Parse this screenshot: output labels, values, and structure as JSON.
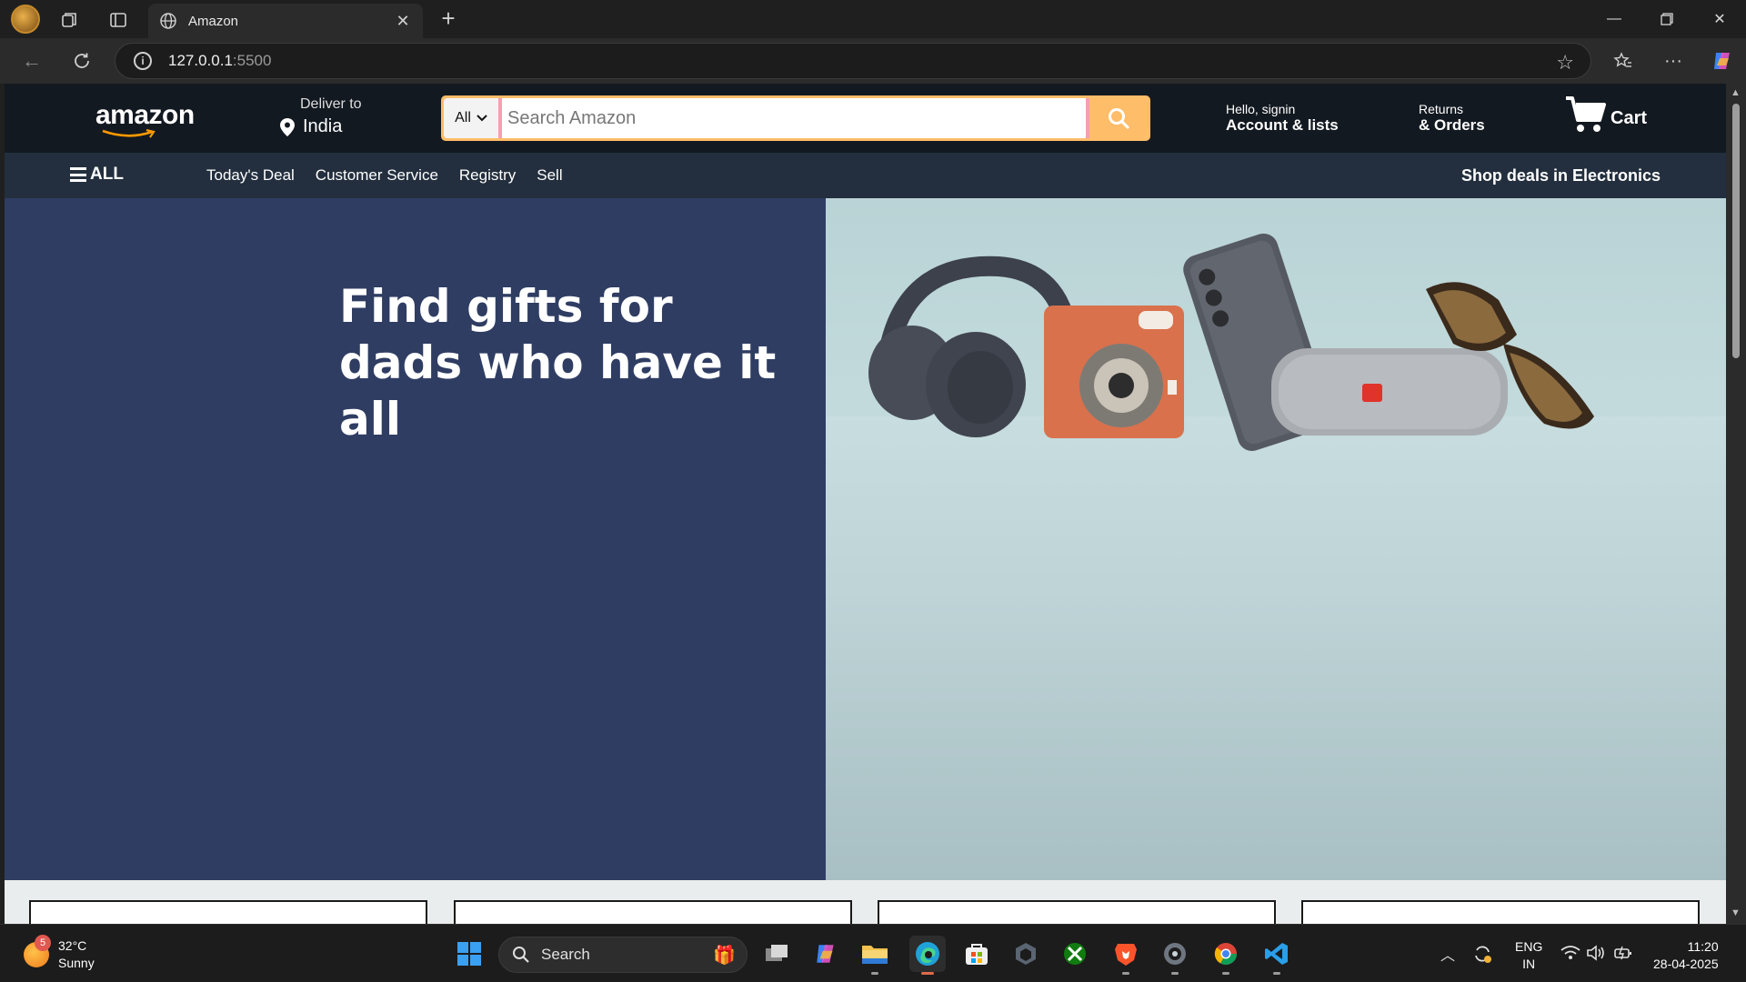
{
  "browser": {
    "tab_title": "Amazon",
    "address_host": "127.0.0.1",
    "address_port": ":5500"
  },
  "amazon": {
    "logo": "amazon",
    "deliver_label": "Deliver to",
    "deliver_country": "India",
    "search_category": "All",
    "search_placeholder": "Search Amazon",
    "account_line1": "Hello, signin",
    "account_line2": "Account & lists",
    "returns_line1": "Returns",
    "returns_line2": "& Orders",
    "cart_label": "Cart",
    "nav_all": "ALL",
    "nav_links": [
      "Today's Deal",
      "Customer Service",
      "Registry",
      "Sell"
    ],
    "nav_deals": "Shop deals in Electronics",
    "hero_line1": "Find gifts for",
    "hero_line2": "dads who have it all"
  },
  "taskbar": {
    "weather_badge": "5",
    "weather_temp": "32°C",
    "weather_desc": "Sunny",
    "search_label": "Search",
    "lang_line1": "ENG",
    "lang_line2": "IN",
    "time": "11:20",
    "date": "28-04-2025"
  },
  "colors": {
    "amazon_dark": "#131921",
    "amazon_nav": "#232f3e",
    "search_orange": "#febd69",
    "hero_blue": "#2f3d63"
  }
}
